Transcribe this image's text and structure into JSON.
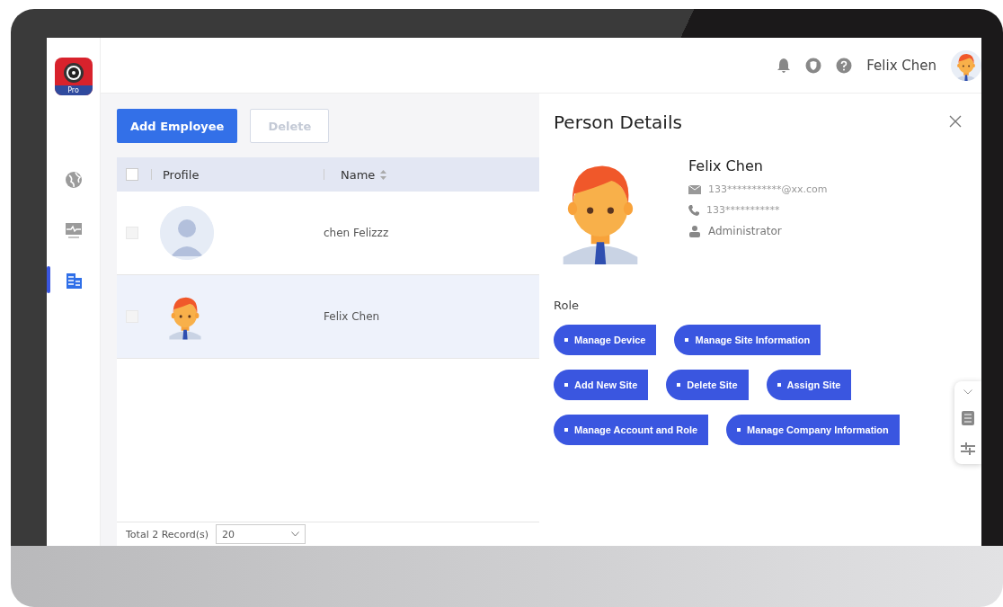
{
  "app": {
    "logo_badge": "Pro"
  },
  "sidebar": {
    "items": [
      {
        "kind": "globe",
        "selected": false
      },
      {
        "kind": "monitor",
        "selected": false
      },
      {
        "kind": "building",
        "selected": true
      }
    ]
  },
  "header": {
    "user_name": "Felix Chen"
  },
  "toolbar": {
    "buttons": [
      {
        "label": "Add Employee",
        "kind": "primary"
      },
      {
        "label": "Delete",
        "kind": "disabled"
      }
    ]
  },
  "table": {
    "select_all_checked": false,
    "columns": [
      "Profile",
      "Name"
    ],
    "rows": [
      {
        "name": "chen Felizzz",
        "kind": "placeholder",
        "checked": false,
        "selected": false
      },
      {
        "name": "Felix Chen",
        "kind": "cartoon",
        "checked": false,
        "selected": true
      }
    ]
  },
  "pagination": {
    "total": "Total 2 Record(s)",
    "page_size": "20"
  },
  "details": {
    "title": "Person Details",
    "name": "Felix Chen",
    "email": "133***********@xx.com",
    "phone": "133***********",
    "role_name": "Administrator",
    "role_label": "Role",
    "permissions": [
      "Manage Device",
      "Manage Site Information",
      "Add New Site",
      "Delete Site",
      "Assign Site",
      "Manage Account and Role",
      "Manage Company Information"
    ]
  }
}
